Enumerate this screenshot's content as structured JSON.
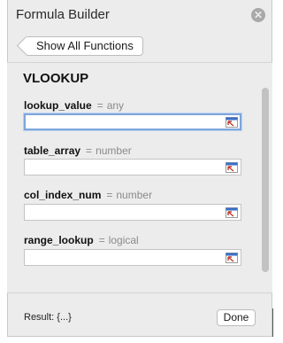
{
  "header": {
    "title": "Formula Builder",
    "close_glyph": "✕",
    "show_all_label": "Show All Functions"
  },
  "function": {
    "name": "VLOOKUP",
    "arguments": [
      {
        "name": "lookup_value",
        "equals": "=",
        "type": "any",
        "value": "",
        "focused": true
      },
      {
        "name": "table_array",
        "equals": "=",
        "type": "number",
        "value": "",
        "focused": false
      },
      {
        "name": "col_index_num",
        "equals": "=",
        "type": "number",
        "value": "",
        "focused": false
      },
      {
        "name": "range_lookup",
        "equals": "=",
        "type": "logical",
        "value": "",
        "focused": false
      }
    ]
  },
  "footer": {
    "result_text": "Result: {...}",
    "done_label": "Done"
  },
  "icons": {
    "close": "close-icon",
    "back": "chevron-left-icon",
    "reference": "collapse-reference-icon"
  },
  "colors": {
    "panel_bg": "#ececec",
    "focus_ring": "#7ea6dc",
    "ref_icon_red": "#c0392b",
    "ref_icon_blue": "#3b6fc4"
  }
}
